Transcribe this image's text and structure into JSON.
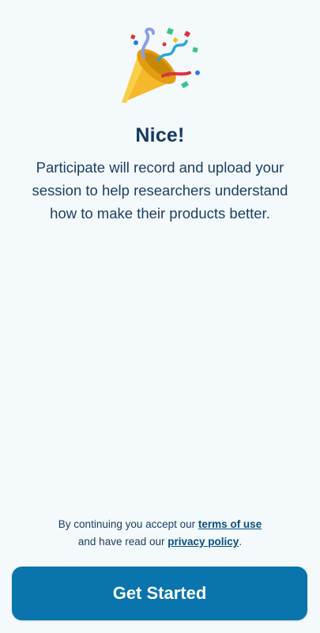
{
  "icon": "party-popper-icon",
  "heading": "Nice!",
  "description": "Participate will record and upload your session to help researchers understand how to make their products better.",
  "legal": {
    "prefix": "By continuing you accept our",
    "terms_link": "terms of use",
    "middle": "and have read our",
    "privacy_link": "privacy policy",
    "suffix": "."
  },
  "cta": {
    "label": "Get Started"
  },
  "colors": {
    "background": "#f4f9fc",
    "heading": "#16395e",
    "link": "#0a4f80",
    "button": "#0a74ad",
    "button_text": "#ffffff"
  }
}
